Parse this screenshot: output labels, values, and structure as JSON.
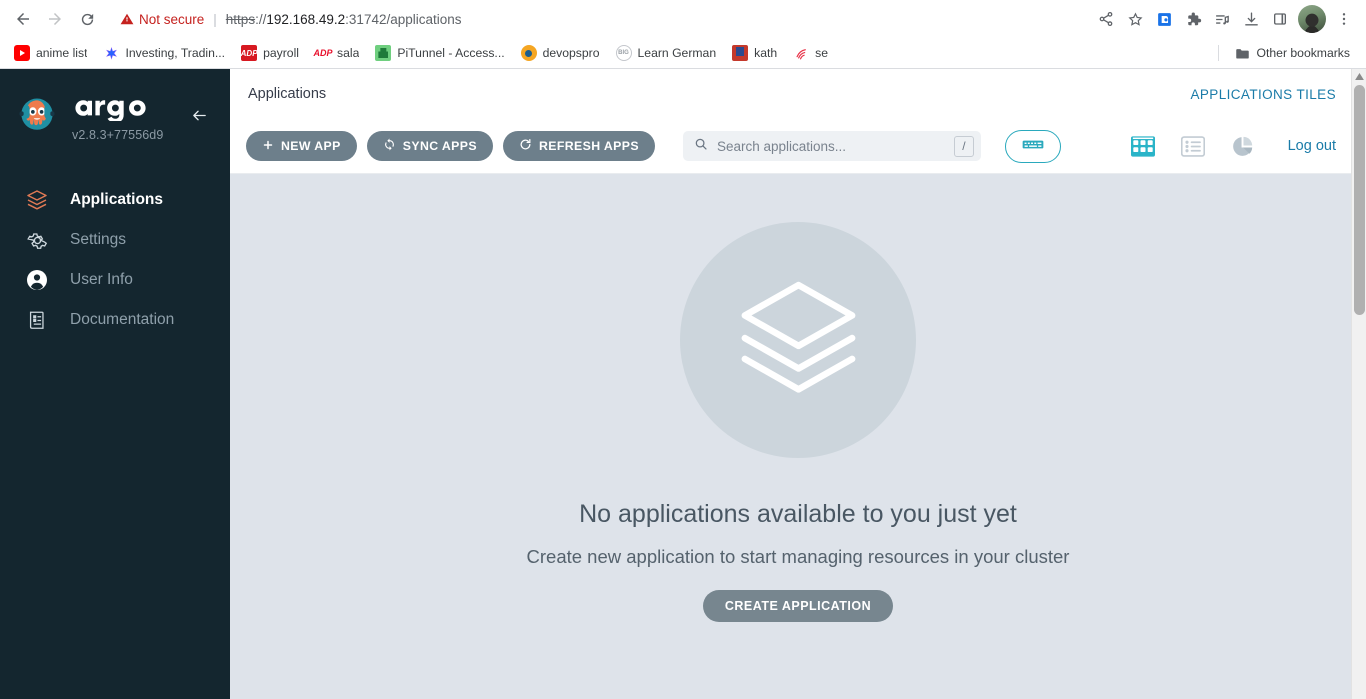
{
  "browser": {
    "nav": {
      "back": "back-arrow",
      "forward": "forward-arrow",
      "reload": "reload"
    },
    "address": {
      "security_label": "Not secure",
      "url_scheme": "https",
      "url_sep": "://",
      "url_host": "192.168.49.2",
      "url_rest": ":31742/applications"
    },
    "toolbar_icons": [
      "share-icon",
      "bookmark-star-icon",
      "extension-blue-icon",
      "puzzle-extensions-icon",
      "playlist-music-icon",
      "download-icon",
      "side-panel-icon",
      "profile-avatar",
      "chrome-menu-icon"
    ],
    "bookmarks": [
      {
        "label": "anime list",
        "icon": "youtube-favicon"
      },
      {
        "label": "Investing, Tradin...",
        "icon": "tradingview-favicon"
      },
      {
        "label": "payroll",
        "icon": "adp-favicon"
      },
      {
        "label": "sala",
        "icon": "adp-outline-favicon"
      },
      {
        "label": "PiTunnel - Access...",
        "icon": "pitunnel-favicon"
      },
      {
        "label": "devopspro",
        "icon": "devopspro-favicon"
      },
      {
        "label": "Learn German",
        "icon": "learn-german-favicon"
      },
      {
        "label": "kath",
        "icon": "book-favicon"
      },
      {
        "label": "se",
        "icon": "wifi-favicon"
      }
    ],
    "other_bookmarks": "Other bookmarks"
  },
  "sidebar": {
    "brand": "argo",
    "version": "v2.8.3+77556d9",
    "collapse_icon": "left-arrow-icon",
    "items": [
      {
        "label": "Applications",
        "icon": "layers-icon",
        "active": true
      },
      {
        "label": "Settings",
        "icon": "gear-icon",
        "active": false
      },
      {
        "label": "User Info",
        "icon": "user-circle-icon",
        "active": false
      },
      {
        "label": "Documentation",
        "icon": "book-doc-icon",
        "active": false
      }
    ]
  },
  "header": {
    "title": "Applications",
    "right_label": "APPLICATIONS TILES"
  },
  "toolbar": {
    "new_app": "NEW APP",
    "sync_apps": "SYNC APPS",
    "refresh_apps": "REFRESH APPS",
    "search_placeholder": "Search applications...",
    "search_value": "",
    "slash_hint": "/",
    "keyboard_button": "keyboard-shortcut-icon",
    "views": [
      {
        "name": "tiles-view-icon",
        "active": true
      },
      {
        "name": "list-view-icon",
        "active": false
      },
      {
        "name": "pie-summary-icon",
        "active": false
      }
    ],
    "logout": "Log out"
  },
  "empty_state": {
    "illustration": "layers-stack-icon",
    "title": "No applications available to you just yet",
    "subtitle": "Create new application to start managing resources in your cluster",
    "cta": "CREATE APPLICATION"
  },
  "colors": {
    "sidebar_bg": "#14262f",
    "content_bg": "#dee3ea",
    "accent_teal": "#2aa9bd",
    "link_blue": "#1a7ba8",
    "button_gray": "#6d7f8b",
    "argo_orange": "#ef7b4d",
    "not_secure_red": "#c5221f"
  }
}
